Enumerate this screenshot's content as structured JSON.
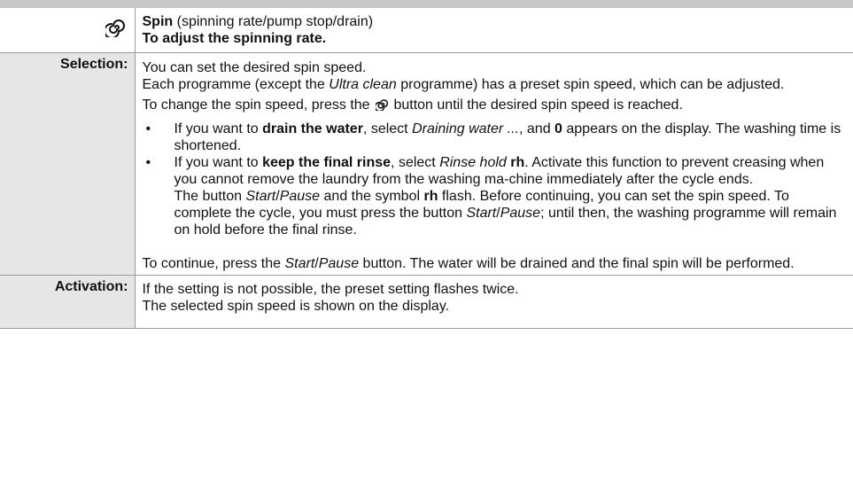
{
  "header": {
    "icon": "spin-icon",
    "title_bold": "Spin",
    "title_rest": " (spinning rate/pump stop/drain)",
    "subtitle": "To adjust the spinning rate."
  },
  "selection": {
    "label": "Selection:",
    "p1": "You can set the desired spin speed.",
    "p2_a": "Each programme (except the ",
    "p2_em": "Ultra clean",
    "p2_b": " programme) has a preset spin speed, which can be adjusted.",
    "p3_a": "To change the spin speed, press the ",
    "p3_b": " button until the desired spin speed is reached.",
    "bullet1": {
      "a": "If you want to ",
      "strong": "drain the water",
      "b": ", select ",
      "em": "Draining water ...",
      "c": ", and ",
      "strong2": "0",
      "d": " appears on the display. The washing time is shortened."
    },
    "bullet2": {
      "a": "If you want to ",
      "strong": "keep the final rinse",
      "b": ", select ",
      "em": "Rinse hold",
      "c": " ",
      "strong2": "rh",
      "d": ". Activate this function to prevent creasing when you cannot remove the laundry from the washing ma-chine immediately after the cycle ends.",
      "e1": "The button ",
      "em2": "Start",
      "e2": "/",
      "em3": "Pause",
      "e3": " and the symbol ",
      "strong3": "rh",
      "e4": " flash. Before continuing, you can set the spin speed. To complete the cycle, you must press the button ",
      "em4": "Start",
      "e5": "/",
      "em5": "Pause",
      "e6": "; until then, the washing programme will remain on hold before the final rinse."
    },
    "p4_a": "To continue, press the ",
    "p4_em": "Start",
    "p4_slash": "/",
    "p4_em2": "Pause",
    "p4_b": " button. The water will be drained and the final spin will be performed."
  },
  "activation": {
    "label": "Activation:",
    "line1": "If the setting is not possible, the preset setting flashes twice.",
    "line2": "The selected spin speed is shown on the display."
  }
}
